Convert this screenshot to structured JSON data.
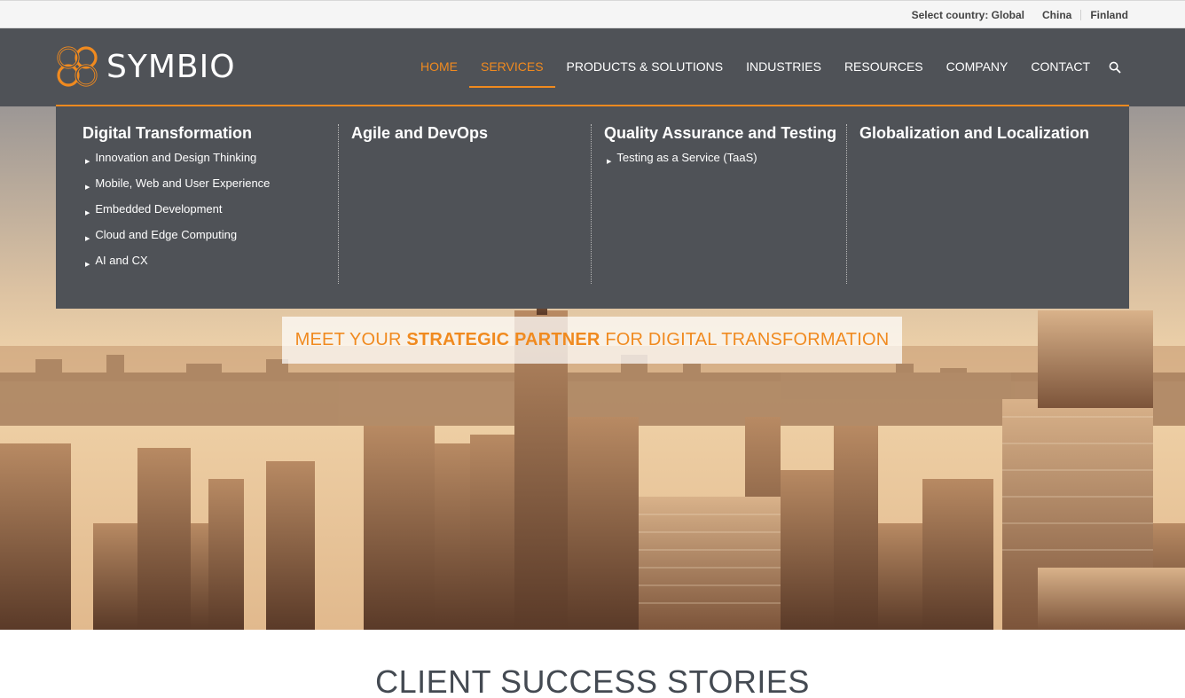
{
  "topbar": {
    "label": "Select country: Global",
    "countries": [
      "China",
      "Finland"
    ]
  },
  "brand": {
    "name": "SYMBIO",
    "accent": "#f08a1f",
    "header_bg": "#4f5257"
  },
  "nav": {
    "items": [
      "HOME",
      "SERVICES",
      "PRODUCTS & SOLUTIONS",
      "INDUSTRIES",
      "RESOURCES",
      "COMPANY",
      "CONTACT"
    ],
    "active": "HOME",
    "open": "SERVICES",
    "search_icon": "search-icon"
  },
  "mega_menu": {
    "columns": [
      {
        "title": "Digital Transformation",
        "items": [
          "Innovation and Design Thinking",
          "Mobile, Web and User Experience",
          "Embedded Development",
          "Cloud and Edge Computing",
          "AI and CX"
        ]
      },
      {
        "title": "Agile and DevOps",
        "items": []
      },
      {
        "title": "Quality Assurance and Testing",
        "items": [
          "Testing as a Service (TaaS)"
        ]
      },
      {
        "title": "Globalization and Localization",
        "items": []
      }
    ]
  },
  "hero": {
    "tagline_pre": "MEET YOUR ",
    "tagline_bold": "STRATEGIC PARTNER",
    "tagline_post": " FOR DIGITAL TRANSFORMATION"
  },
  "section": {
    "title": "CLIENT SUCCESS STORIES"
  }
}
